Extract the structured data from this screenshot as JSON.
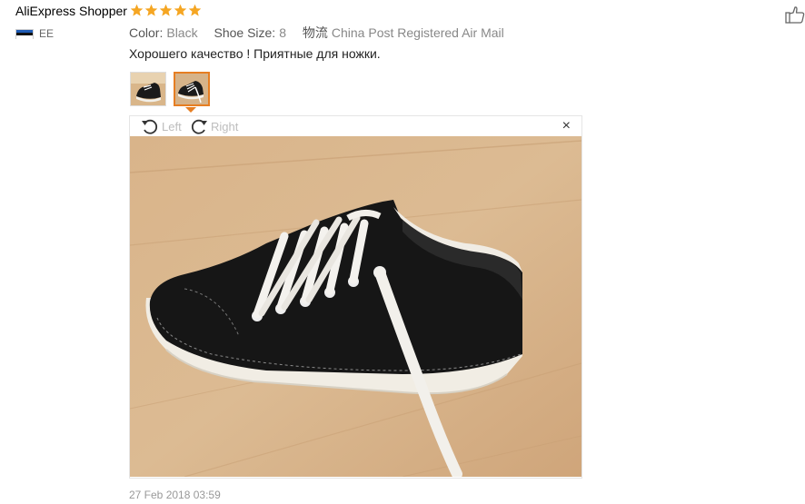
{
  "review": {
    "user_name": "AliExpress Shopper",
    "rating": 5,
    "country_code": "EE",
    "color_label": "Color:",
    "color_value": "Black",
    "size_label": "Shoe Size:",
    "size_value": "8",
    "shipping_label": "物流",
    "shipping_value": "China Post Registered Air Mail",
    "text": "Хорошего качество ! Приятные для ножки.",
    "date": "27 Feb 2018 03:59"
  },
  "viewer": {
    "rotate_left_label": "Left",
    "rotate_right_label": "Right",
    "close_symbol": "×",
    "selected_thumb_index": 1
  },
  "colors": {
    "star": "#f5a623",
    "accent": "#e67e22"
  },
  "icons": [
    "star-icon",
    "thumb-up-icon",
    "rotate-left-icon",
    "rotate-right-icon",
    "close-icon",
    "flag-icon"
  ]
}
